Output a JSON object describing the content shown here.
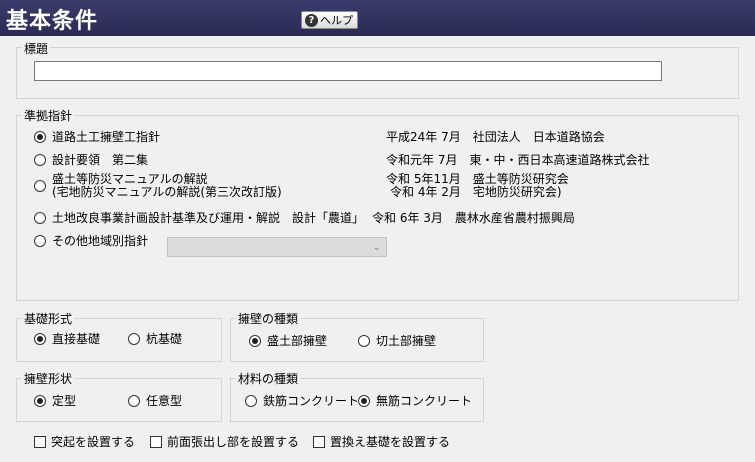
{
  "header": {
    "title": "基本条件",
    "help_label": "ヘルプ"
  },
  "title_field": {
    "legend": "標題",
    "value": ""
  },
  "standard": {
    "legend": "準拠指針",
    "options": [
      {
        "label": "道路土工擁壁工指針",
        "selected": true,
        "info": [
          "平成24年 7月　社団法人　日本道路協会"
        ]
      },
      {
        "label": "設計要領　第二集",
        "selected": false,
        "info": [
          "令和元年 7月　東・中・西日本高速道路株式会社"
        ]
      },
      {
        "label": "盛土等防災マニュアルの解説",
        "label2": "(宅地防災マニュアルの解説(第三次改訂版)",
        "selected": false,
        "info": [
          "令和 5年11月　盛土等防災研究会",
          "令和 4年 2月　宅地防災研究会)"
        ]
      },
      {
        "label": "土地改良事業計画設計基準及び運用・解説　設計「農道」",
        "selected": false,
        "info": [
          "令和 6年 3月　農林水産省農村振興局"
        ]
      },
      {
        "label": "その他地域別指針",
        "selected": false,
        "info": []
      }
    ],
    "region_select_value": ""
  },
  "foundation": {
    "legend": "基礎形式",
    "options": [
      {
        "label": "直接基礎",
        "selected": true
      },
      {
        "label": "杭基礎",
        "selected": false
      }
    ]
  },
  "wall_kind": {
    "legend": "擁壁の種類",
    "options": [
      {
        "label": "盛土部擁壁",
        "selected": true
      },
      {
        "label": "切土部擁壁",
        "selected": false
      }
    ]
  },
  "wall_shape": {
    "legend": "擁壁形状",
    "options": [
      {
        "label": "定型",
        "selected": true
      },
      {
        "label": "任意型",
        "selected": false
      }
    ]
  },
  "material": {
    "legend": "材料の種類",
    "options": [
      {
        "label": "鉄筋コンクリート",
        "selected": false
      },
      {
        "label": "無筋コンクリート",
        "selected": true
      }
    ]
  },
  "checks": [
    {
      "label": "突起を設置する",
      "checked": false
    },
    {
      "label": "前面張出し部を設置する",
      "checked": false
    },
    {
      "label": "置換え基礎を設置する",
      "checked": false
    }
  ]
}
